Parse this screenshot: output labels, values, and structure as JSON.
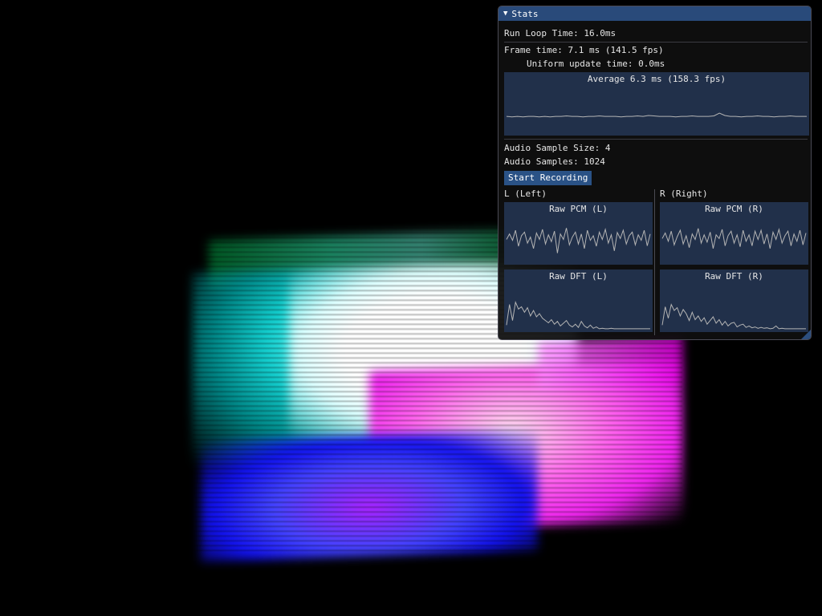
{
  "window": {
    "title": "Stats",
    "collapse_glyph": "▼"
  },
  "stats": {
    "run_loop": "Run Loop Time: 16.0ms",
    "frame_time": "Frame time: 7.1 ms (141.5 fps)",
    "uniform_update": "Uniform update time: 0.0ms",
    "frame_plot_title": "Average 6.3 ms (158.3 fps)",
    "audio_sample_size": "Audio Sample Size: 4",
    "audio_samples": "Audio Samples: 1024",
    "record_button": "Start Recording",
    "left_header": "L (Left)",
    "right_header": "R (Right)",
    "pcm_left_title": "Raw PCM (L)",
    "pcm_right_title": "Raw PCM (R)",
    "dft_left_title": "Raw DFT (L)",
    "dft_right_title": "Raw DFT (R)"
  },
  "colors": {
    "title_bar": "#294a7a",
    "plot_bg": "#21304a",
    "plot_line": "#b4b4b4",
    "button": "#2a5286"
  },
  "plot_series": {
    "frame_times": [
      0.36,
      0.35,
      0.36,
      0.35,
      0.36,
      0.36,
      0.35,
      0.36,
      0.35,
      0.36,
      0.36,
      0.37,
      0.36,
      0.36,
      0.35,
      0.36,
      0.36,
      0.37,
      0.36,
      0.36,
      0.36,
      0.35,
      0.36,
      0.36,
      0.37,
      0.36,
      0.38,
      0.37,
      0.36,
      0.36,
      0.36,
      0.35,
      0.36,
      0.36,
      0.37,
      0.36,
      0.36,
      0.36,
      0.37,
      0.43,
      0.38,
      0.36,
      0.36,
      0.35,
      0.36,
      0.36,
      0.37,
      0.36,
      0.36,
      0.35,
      0.36,
      0.36,
      0.37,
      0.36,
      0.36,
      0.36
    ],
    "pcm_left": [
      0.5,
      0.62,
      0.48,
      0.7,
      0.35,
      0.58,
      0.66,
      0.42,
      0.55,
      0.3,
      0.64,
      0.5,
      0.72,
      0.4,
      0.6,
      0.45,
      0.68,
      0.2,
      0.62,
      0.5,
      0.75,
      0.38,
      0.55,
      0.66,
      0.4,
      0.62,
      0.3,
      0.7,
      0.48,
      0.58,
      0.35,
      0.66,
      0.5,
      0.72,
      0.42,
      0.6,
      0.25,
      0.65,
      0.52,
      0.7,
      0.4,
      0.58,
      0.66,
      0.38,
      0.6,
      0.48,
      0.7,
      0.36,
      0.62
    ],
    "pcm_right": [
      0.52,
      0.64,
      0.46,
      0.68,
      0.38,
      0.56,
      0.7,
      0.4,
      0.58,
      0.32,
      0.62,
      0.5,
      0.74,
      0.42,
      0.6,
      0.44,
      0.66,
      0.3,
      0.6,
      0.52,
      0.72,
      0.36,
      0.58,
      0.68,
      0.42,
      0.6,
      0.34,
      0.7,
      0.46,
      0.6,
      0.36,
      0.68,
      0.5,
      0.7,
      0.4,
      0.62,
      0.3,
      0.66,
      0.5,
      0.72,
      0.42,
      0.58,
      0.68,
      0.36,
      0.62,
      0.46,
      0.7,
      0.38,
      0.64
    ],
    "dft_left": [
      0.1,
      0.55,
      0.2,
      0.6,
      0.45,
      0.5,
      0.38,
      0.48,
      0.3,
      0.42,
      0.28,
      0.35,
      0.25,
      0.2,
      0.15,
      0.22,
      0.12,
      0.18,
      0.08,
      0.14,
      0.2,
      0.1,
      0.06,
      0.12,
      0.05,
      0.18,
      0.08,
      0.04,
      0.1,
      0.03,
      0.06,
      0.02,
      0.03,
      0.02,
      0.02,
      0.03,
      0.02,
      0.02,
      0.02,
      0.02,
      0.02,
      0.02,
      0.02,
      0.02,
      0.02,
      0.02,
      0.02,
      0.02,
      0.02
    ],
    "dft_right": [
      0.1,
      0.5,
      0.25,
      0.55,
      0.42,
      0.48,
      0.3,
      0.44,
      0.35,
      0.2,
      0.38,
      0.22,
      0.3,
      0.18,
      0.26,
      0.12,
      0.2,
      0.28,
      0.14,
      0.22,
      0.1,
      0.18,
      0.08,
      0.14,
      0.16,
      0.06,
      0.1,
      0.12,
      0.05,
      0.08,
      0.04,
      0.06,
      0.03,
      0.05,
      0.03,
      0.04,
      0.02,
      0.03,
      0.08,
      0.02,
      0.03,
      0.02,
      0.02,
      0.02,
      0.02,
      0.02,
      0.02,
      0.02,
      0.02
    ]
  }
}
